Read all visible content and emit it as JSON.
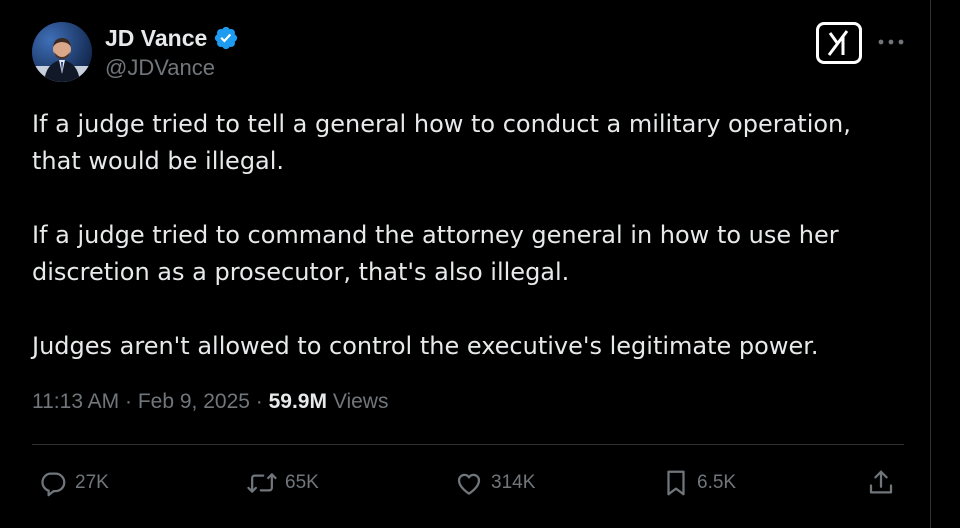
{
  "author": {
    "display_name": "JD Vance",
    "handle": "@JDVance",
    "verified": true
  },
  "header_icons": {
    "grok": "grok-logo-icon",
    "more": "more-options-icon"
  },
  "tweet": {
    "paragraphs": [
      "If a judge tried to tell a general how to conduct a military operation, that would be illegal.",
      "If a judge tried to command the attorney general in how to use her discretion as a prosecutor, that's also illegal.",
      "Judges aren't allowed to control the executive's legitimate power."
    ]
  },
  "meta": {
    "time": "11:13 AM",
    "separator": " · ",
    "date": "Feb 9, 2025",
    "views_count": "59.9M",
    "views_label": "Views"
  },
  "actions": {
    "replies": "27K",
    "reposts": "65K",
    "likes": "314K",
    "bookmarks": "6.5K"
  },
  "colors": {
    "background": "#000000",
    "text_primary": "#e7e9ea",
    "text_secondary": "#71767b",
    "verified_badge": "#1d9bf0",
    "divider": "#2f3336"
  }
}
